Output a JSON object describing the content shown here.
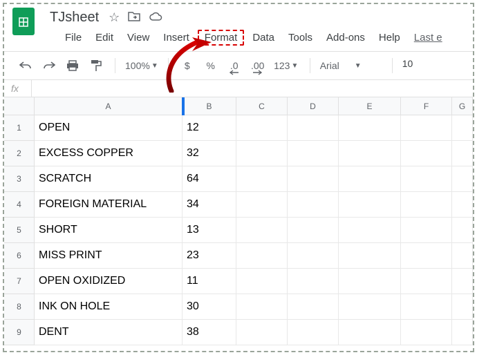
{
  "header": {
    "doc_name": "TJsheet"
  },
  "menubar": {
    "items": [
      "File",
      "Edit",
      "View",
      "Insert",
      "Format",
      "Data",
      "Tools",
      "Add-ons",
      "Help"
    ],
    "highlighted_index": 4,
    "last_edit": "Last e"
  },
  "toolbar": {
    "zoom": "100%",
    "currency": "$",
    "percent": "%",
    "dec_dec": ".0",
    "inc_dec": ".00",
    "more_formats": "123",
    "font": "Arial",
    "font_size": "10"
  },
  "fx": {
    "label": "fx"
  },
  "columns": [
    "A",
    "B",
    "C",
    "D",
    "E",
    "F",
    "G"
  ],
  "rows": [
    {
      "n": "1",
      "a": "OPEN",
      "b": "12"
    },
    {
      "n": "2",
      "a": "EXCESS COPPER",
      "b": "32"
    },
    {
      "n": "3",
      "a": "SCRATCH",
      "b": "64"
    },
    {
      "n": "4",
      "a": "FOREIGN MATERIAL",
      "b": "34"
    },
    {
      "n": "5",
      "a": "SHORT",
      "b": "13"
    },
    {
      "n": "6",
      "a": "MISS PRINT",
      "b": "23"
    },
    {
      "n": "7",
      "a": "OPEN OXIDIZED",
      "b": "11"
    },
    {
      "n": "8",
      "a": "INK ON HOLE",
      "b": "30"
    },
    {
      "n": "9",
      "a": "DENT",
      "b": "38"
    }
  ]
}
